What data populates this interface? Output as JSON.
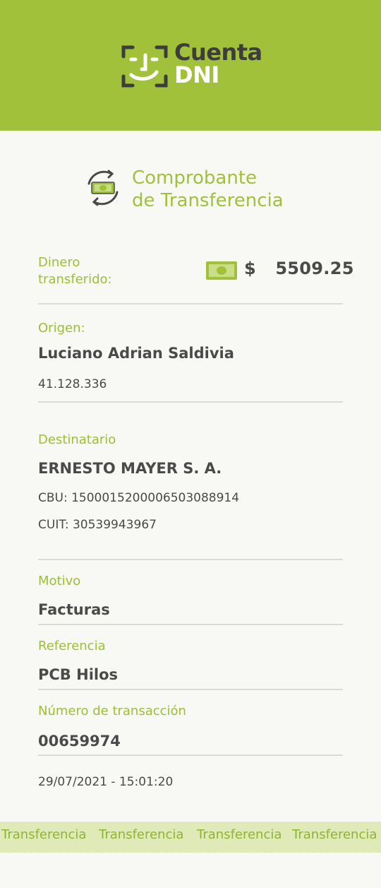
{
  "brand": {
    "line1": "Cuenta",
    "line2": "DNI"
  },
  "receipt": {
    "title_line1": "Comprobante",
    "title_line2": "de Transferencia",
    "amount_label_line1": "Dinero",
    "amount_label_line2": "transferido:",
    "currency_symbol": "$",
    "amount": "5509.25",
    "origin_label": "Origen:",
    "origin_name": "Luciano Adrian Saldivia",
    "origin_dni": "41.128.336",
    "recipient_label": "Destinatario",
    "recipient_name": "ERNESTO MAYER S. A.",
    "recipient_cbu": "CBU: 1500015200006503088914",
    "recipient_cuit": "CUIT: 30539943967",
    "reason_label": "Motivo",
    "reason_value": "Facturas",
    "reference_label": "Referencia",
    "reference_value": "PCB Hilos",
    "transaction_label": "Número de transacción",
    "transaction_value": "00659974",
    "datetime": "29/07/2021 - 15:01:20"
  },
  "footer": {
    "band_items": [
      "Transferencia",
      "Transferencia",
      "Transferencia",
      "Transferencia"
    ]
  },
  "icons": {
    "logo": "face-id-icon",
    "title": "money-transfer-icon",
    "amount": "banknote-icon"
  },
  "colors": {
    "header_green": "#a2c13a",
    "label_green": "#9dbf35",
    "text_dark": "#4a4a4a",
    "band_green": "#dfeab8"
  }
}
